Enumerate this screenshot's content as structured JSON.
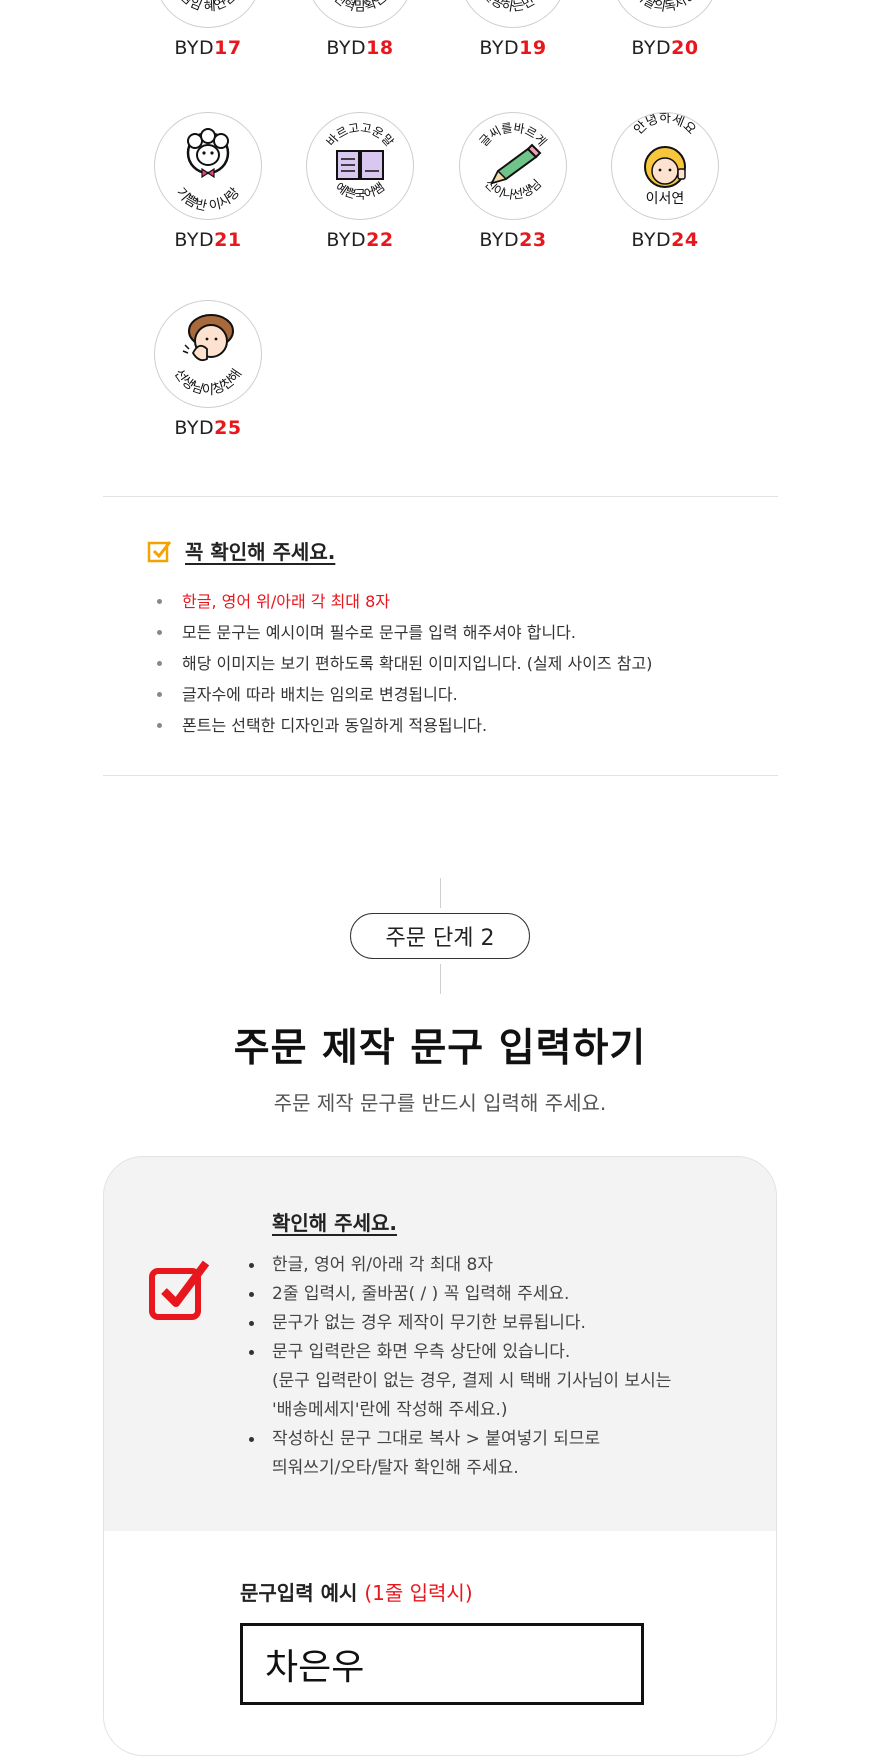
{
  "stamps_row0": [
    {
      "prefix": "BYD",
      "num": "17",
      "text": "담임 혜연쌤"
    },
    {
      "prefix": "BYD",
      "num": "18",
      "text": "친혁맘확인"
    },
    {
      "prefix": "BYD",
      "num": "19",
      "text": "열공하는민혁"
    },
    {
      "prefix": "BYD",
      "num": "20",
      "text": "이달의독서왕"
    }
  ],
  "stamps_row1": [
    {
      "prefix": "BYD",
      "num": "21",
      "top": "",
      "bottom": "기쁨반 이사랑",
      "icon": "sheep-icon"
    },
    {
      "prefix": "BYD",
      "num": "22",
      "top": "바르고고운말",
      "bottom": "예쁜국어쌤",
      "icon": "book-icon"
    },
    {
      "prefix": "BYD",
      "num": "23",
      "top": "글씨를바르게",
      "bottom": "신이나선생님",
      "icon": "pencil-icon"
    },
    {
      "prefix": "BYD",
      "num": "24",
      "top": "안녕하세요",
      "bottom": "이서연",
      "icon": "girl-thumbs-up-icon"
    }
  ],
  "stamps_row2": [
    {
      "prefix": "BYD",
      "num": "25",
      "top": "",
      "bottom": "선생님이칭찬해",
      "icon": "clapping-boy-icon"
    }
  ],
  "notice1": {
    "title": "꼭 확인해 주세요.",
    "items": [
      "한글, 영어 위/아래 각 최대 8자",
      "모든 문구는 예시이며 필수로 문구를 입력 해주셔야 합니다.",
      "해당 이미지는 보기 편하도록 확대된 이미지입니다. (실제 사이즈 참고)",
      "글자수에 따라 배치는 임의로 변경됩니다.",
      "폰트는 선택한 디자인과 동일하게 적용됩니다."
    ],
    "highlight_color": "#e8161d"
  },
  "step": {
    "pill": "주문 단계 2",
    "heading": "주문 제작 문구 입력하기",
    "subheading": "주문 제작 문구를 반드시 입력해 주세요."
  },
  "card": {
    "title": "확인해 주세요.",
    "items": [
      "한글, 영어 위/아래 각 최대 8자",
      "2줄 입력시, 줄바꿈( / ) 꼭 입력해 주세요.",
      "문구가 없는 경우 제작이 무기한 보류됩니다.",
      "문구 입력란은 화면 우측 상단에 있습니다.",
      "(문구 입력란이 없는 경우, 결제 시 택배 기사님이 보시는",
      "'배송메세지'란에 작성해 주세요.)",
      "작성하신 문구 그대로 복사 > 붙여넣기 되므로",
      "띄워쓰기/오타/탈자 확인해 주세요."
    ],
    "example_label": "문구입력 예시",
    "example_label_note": "(1줄 입력시)",
    "example_value": "차은우"
  },
  "colors": {
    "accent_red": "#e8161d",
    "check_orange": "#f5a300"
  }
}
